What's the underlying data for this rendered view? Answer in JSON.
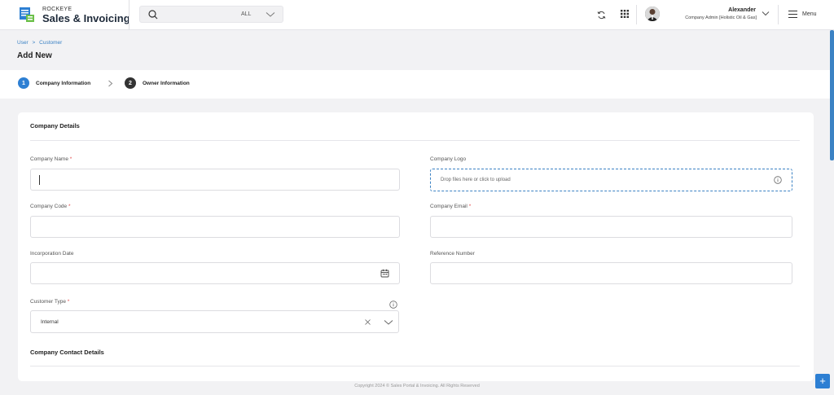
{
  "app": {
    "brand_small": "ROCKEYE",
    "brand_title": "Sales & Invoicing"
  },
  "search": {
    "scope": "ALL",
    "icon": "search-icon"
  },
  "user": {
    "name": "Alexander",
    "role": "Company Admin [Holistic Oil & Gas]"
  },
  "menu": {
    "label": "Menu"
  },
  "breadcrumb": {
    "item1": "User",
    "separator": ">",
    "item2": "Customer"
  },
  "page": {
    "title": "Add New"
  },
  "steps": [
    {
      "number": "1",
      "label": "Company Information",
      "color": "#2d7fd3"
    },
    {
      "number": "2",
      "label": "Owner Information",
      "color": "#333333"
    }
  ],
  "sections": {
    "company_details": "Company Details",
    "company_contact": "Company Contact Details"
  },
  "fields": {
    "company_name": {
      "label": "Company Name",
      "required": "*",
      "value": ""
    },
    "company_logo": {
      "label": "Company Logo",
      "placeholder": "Drop files here or click to upload"
    },
    "company_code": {
      "label": "Company Code",
      "required": "*",
      "value": ""
    },
    "company_email": {
      "label": "Company Email",
      "required": "*",
      "value": ""
    },
    "incorporation_date": {
      "label": "Incorporation Date",
      "value": ""
    },
    "reference_number": {
      "label": "Reference Number",
      "value": ""
    },
    "customer_type": {
      "label": "Customer Type",
      "required": "*",
      "value": "Internal"
    }
  },
  "footer": {
    "text": "Copyright 2024 © Sales Portal & Invoicing. All Rights Reserved"
  },
  "fab": {
    "label": "+"
  },
  "colors": {
    "accent": "#2d7fd3",
    "required": "#e24c4c"
  }
}
